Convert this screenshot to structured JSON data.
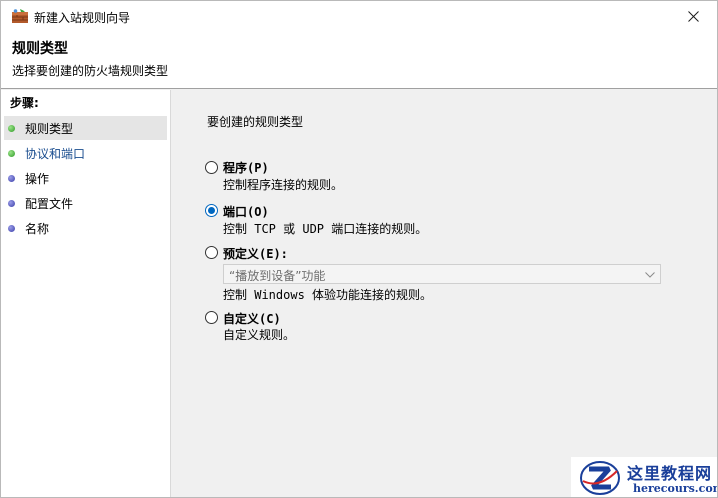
{
  "window": {
    "title": "新建入站规则向导"
  },
  "header": {
    "title": "规则类型",
    "subtitle": "选择要创建的防火墙规则类型"
  },
  "steps": {
    "title": "步骤:",
    "items": [
      {
        "label": "规则类型",
        "state": "current"
      },
      {
        "label": "协议和端口",
        "state": "link"
      },
      {
        "label": "操作",
        "state": "pending"
      },
      {
        "label": "配置文件",
        "state": "pending"
      },
      {
        "label": "名称",
        "state": "pending"
      }
    ]
  },
  "main": {
    "prompt": "要创建的规则类型",
    "options": [
      {
        "label": "程序(P)",
        "desc": "控制程序连接的规则。",
        "checked": false
      },
      {
        "label": "端口(O)",
        "desc": "控制 TCP 或 UDP 端口连接的规则。",
        "checked": true
      },
      {
        "label": "预定义(E):",
        "desc": "控制 Windows 体验功能连接的规则。",
        "checked": false
      },
      {
        "label": "自定义(C)",
        "desc": "自定义规则。",
        "checked": false
      }
    ],
    "predefined_select": {
      "value": "“播放到设备”功能",
      "disabled": true
    }
  },
  "watermark": {
    "name": "这里教程网",
    "domain": "herecours.com"
  },
  "colors": {
    "accent": "#0067c0",
    "link": "#1a4d8f",
    "step_current_bg": "#e5e5e5"
  }
}
